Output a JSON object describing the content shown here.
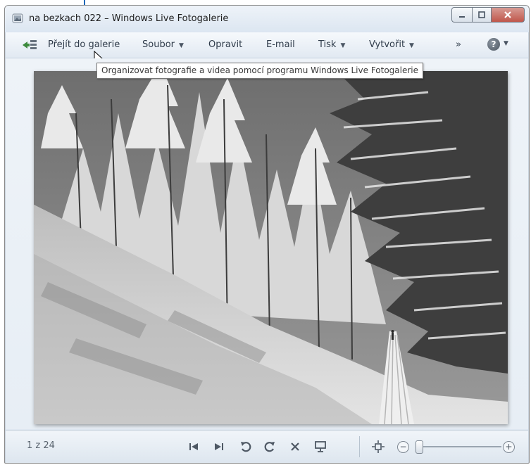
{
  "window": {
    "title": "na bezkach 022 – Windows Live Fotogalerie"
  },
  "toolbar": {
    "goto_gallery": "Přejít do galerie",
    "file": "Soubor",
    "fix": "Opravit",
    "email": "E-mail",
    "print": "Tisk",
    "create": "Vytvořit",
    "more": "»"
  },
  "tooltip": {
    "text": "Organizovat fotografie a videa pomocí programu Windows Live Fotogalerie"
  },
  "status": {
    "counter": "1 z 24"
  },
  "icons": [
    "app-icon",
    "goto-gallery-icon",
    "help-icon",
    "previous-icon",
    "next-icon",
    "rotate-left-icon",
    "rotate-right-icon",
    "delete-icon",
    "slideshow-icon",
    "actual-size-icon",
    "zoom-out-icon",
    "zoom-in-icon"
  ],
  "colors": {
    "callout_arrow": "#1a66b8",
    "close_button": "#c0574b"
  }
}
